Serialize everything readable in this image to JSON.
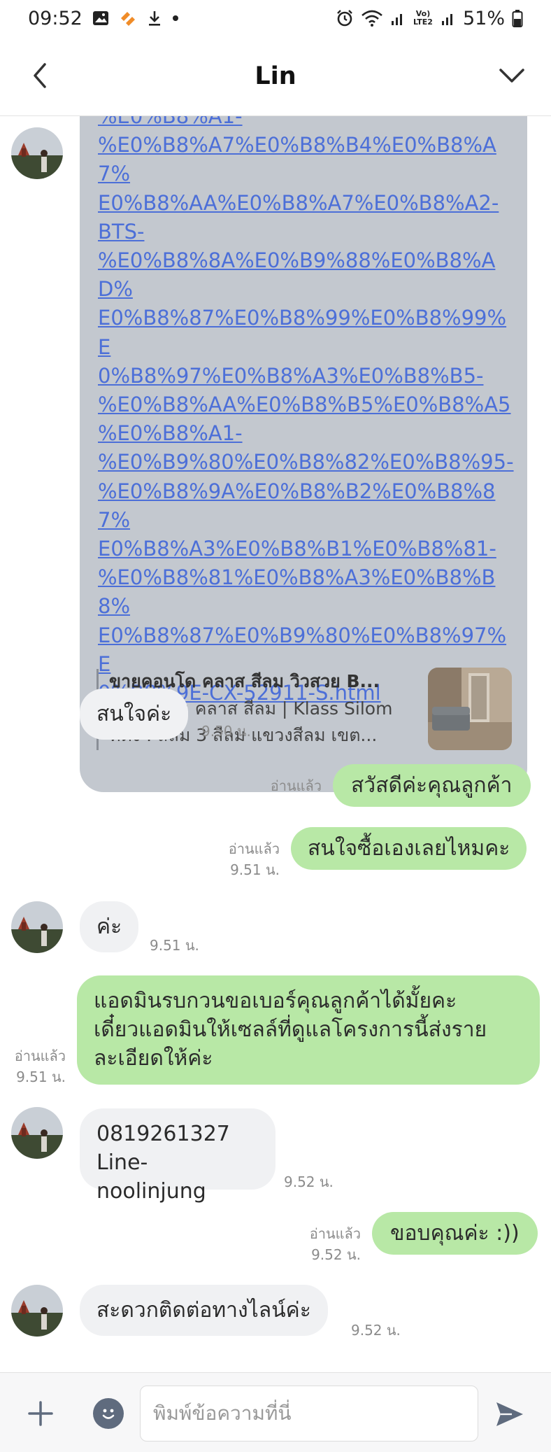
{
  "status_bar": {
    "time": "09:52",
    "battery": "51%",
    "network": "Vo) LTE2"
  },
  "header": {
    "title": "Lin"
  },
  "link_message": {
    "lines": [
      "%E0%B8%A1-",
      "%E0%B8%A7%E0%B8%B4%E0%B8%A7%",
      "E0%B8%AA%E0%B8%A7%E0%B8%A2-",
      "BTS-",
      "%E0%B8%8A%E0%B9%88%E0%B8%AD%",
      "E0%B8%87%E0%B8%99%E0%B8%99%E",
      "0%B8%97%E0%B8%A3%E0%B8%B5-",
      "%E0%B8%AA%E0%B8%B5%E0%B8%A5",
      "%E0%B8%A1-",
      "%E0%B9%80%E0%B8%82%E0%B8%95-",
      "%E0%B8%9A%E0%B8%B2%E0%B8%87%",
      "E0%B8%A3%E0%B8%B1%E0%B8%81-",
      "%E0%B8%81%E0%B8%A3%E0%B8%B8%",
      "E0%B8%87%E0%B9%80%E0%B8%97%E",
      "0%B8%9E-CX-52911-S.html"
    ],
    "preview_title": "ขายคอนโด คลาส สีลม วิวสวย B...",
    "preview_line1": "โครงการ : คลาส สีลม | Klass Silom",
    "preview_line2": "ที่ตั้ง : สีลม 3 สีลม แขวงสีลม เขต..."
  },
  "messages": {
    "m1": {
      "text": "สนใจค่ะ",
      "time": "9.50 น."
    },
    "m2": {
      "text": "สวัสดีค่ะคุณลูกค้า",
      "read": "อ่านแล้ว"
    },
    "m3": {
      "text": "สนใจซื้อเองเลยไหมคะ",
      "read": "อ่านแล้ว",
      "time": "9.51 น."
    },
    "m4": {
      "text": "ค่ะ",
      "time": "9.51 น."
    },
    "m5": {
      "line1": "แอดมินรบกวนขอเบอร์คุณลูกค้าได้มั้ยคะ",
      "line2": "เดี๋ยวแอดมินให้เซลล์ที่ดูแลโครงการนี้ส่งราย",
      "line3": "ละเอียดให้ค่ะ",
      "read": "อ่านแล้ว",
      "time": "9.51 น."
    },
    "m6": {
      "line1": "0819261327",
      "line2": "Line- noolinjung",
      "time": "9.52 น."
    },
    "m7": {
      "text": "ขอบคุณค่ะ :))",
      "read": "อ่านแล้ว",
      "time": "9.52 น."
    },
    "m8": {
      "text": "สะดวกติดต่อทางไลน์ค่ะ",
      "time": "9.52 น."
    }
  },
  "input_bar": {
    "placeholder": "พิมพ์ข้อความที่นี่"
  },
  "colors": {
    "outgoing_bubble": "#b8e8a6",
    "incoming_bubble": "#f0f1f3",
    "link_bubble": "#c3c8cf",
    "link_text": "#4c6fd8"
  }
}
